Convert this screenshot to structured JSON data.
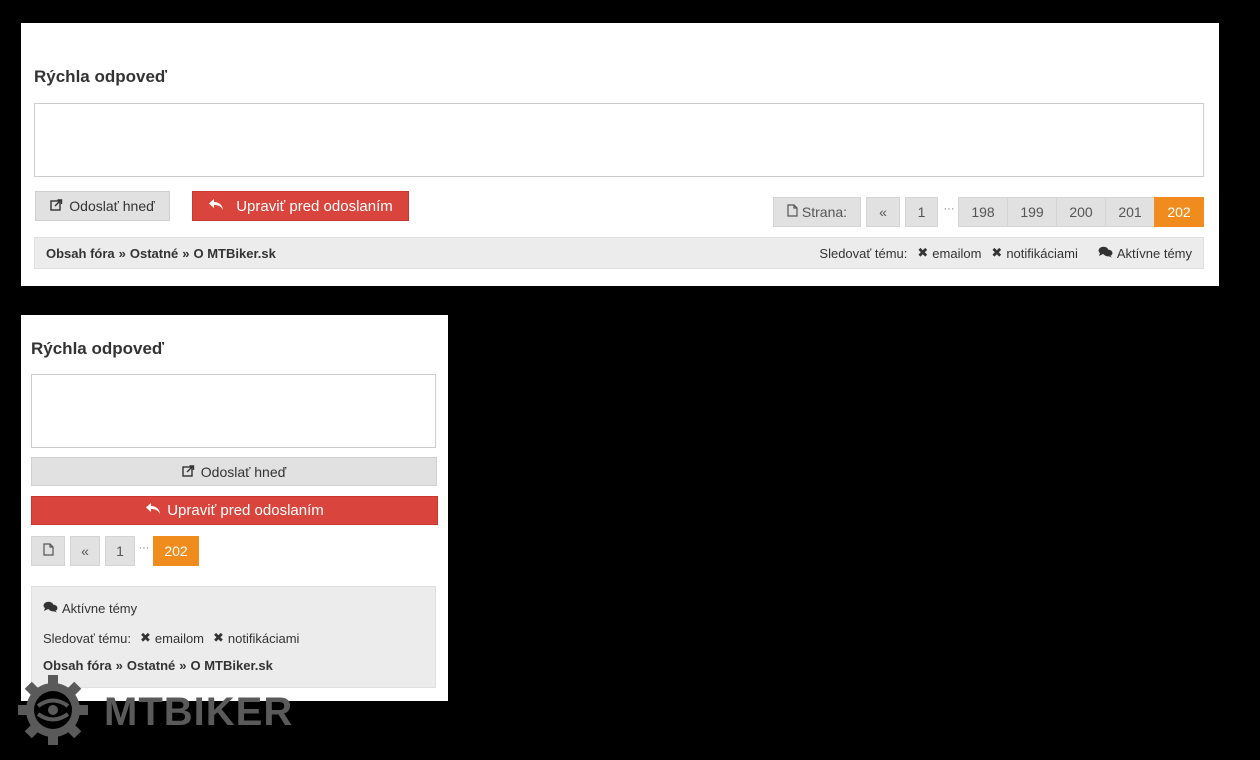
{
  "quick_reply": {
    "title": "Rýchla odpoveď"
  },
  "buttons": {
    "send_now": "Odoslať hneď",
    "edit_before_send": "Upraviť pred odoslaním"
  },
  "pagination": {
    "label": "Strana:",
    "prev": "«",
    "first": "1",
    "ellipsis": "···",
    "pages": [
      "198",
      "199",
      "200",
      "201"
    ],
    "current": "202"
  },
  "breadcrumb": {
    "items": [
      "Obsah fóra",
      "Ostatné",
      "O MTBiker.sk"
    ],
    "separator": "»"
  },
  "follow": {
    "label": "Sledovať tému:",
    "email": "emailom",
    "notifications": "notifikáciami"
  },
  "active_topics": "Aktívne témy",
  "logo": {
    "text": "MTBIKER"
  },
  "colors": {
    "accent_orange": "#f08c1e",
    "button_red": "#d9453c",
    "button_grey": "#e1e1e1",
    "bar_grey": "#ececec"
  }
}
